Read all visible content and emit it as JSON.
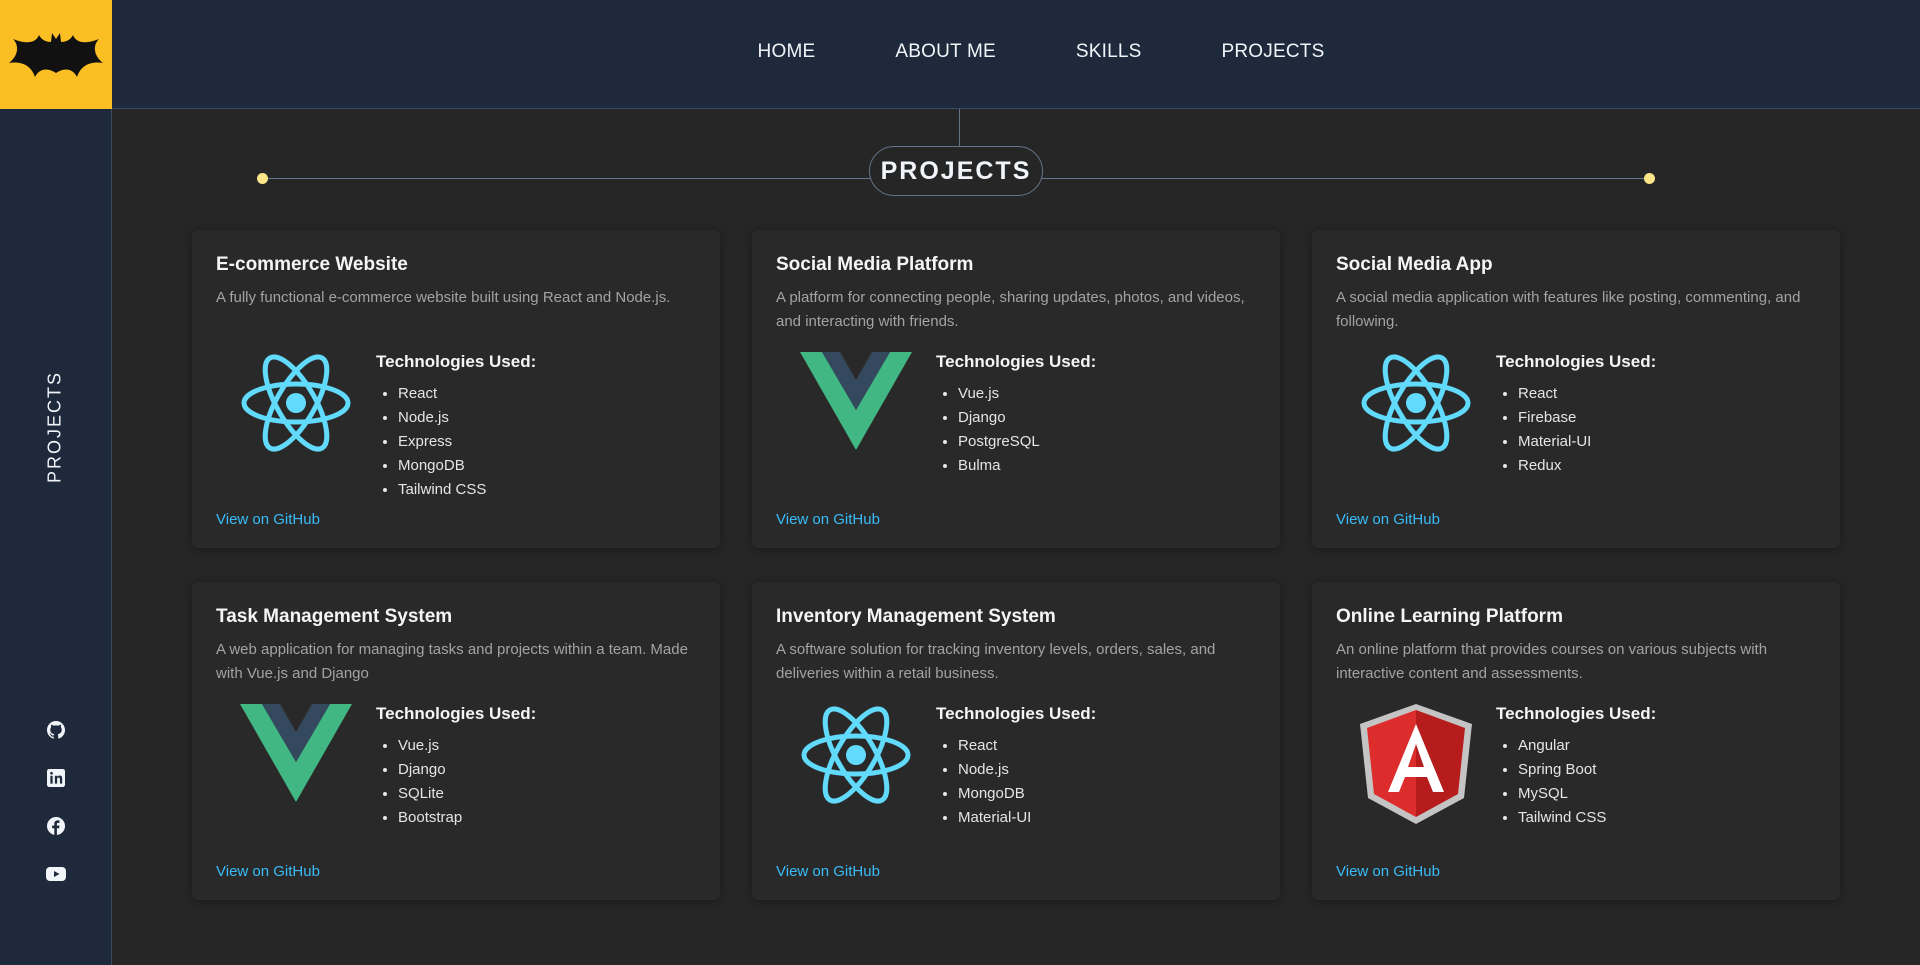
{
  "nav": {
    "items": [
      "HOME",
      "ABOUT ME",
      "SKILLS",
      "PROJECTS"
    ]
  },
  "sidebar": {
    "label": "PROJECTS",
    "social_icons": [
      "github-icon",
      "linkedin-icon",
      "facebook-icon",
      "youtube-icon"
    ]
  },
  "section": {
    "title": "PROJECTS"
  },
  "colors": {
    "accent": "#fbbf24",
    "link": "#38bdf8",
    "nav_bg": "#1e293b",
    "card_bg": "#292929"
  },
  "tech_heading": "Technologies Used:",
  "projects": [
    {
      "title": "E-commerce Website",
      "description": "A fully functional e-commerce website built using React and Node.js.",
      "logo": "react-logo-icon",
      "technologies": [
        "React",
        "Node.js",
        "Express",
        "MongoDB",
        "Tailwind CSS"
      ],
      "link_label": "View on GitHub"
    },
    {
      "title": "Social Media Platform",
      "description": "A platform for connecting people, sharing updates, photos, and videos, and interacting with friends.",
      "logo": "vue-logo-icon",
      "technologies": [
        "Vue.js",
        "Django",
        "PostgreSQL",
        "Bulma"
      ],
      "link_label": "View on GitHub"
    },
    {
      "title": "Social Media App",
      "description": "A social media application with features like posting, commenting, and following.",
      "logo": "react-logo-icon",
      "technologies": [
        "React",
        "Firebase",
        "Material-UI",
        "Redux"
      ],
      "link_label": "View on GitHub"
    },
    {
      "title": "Task Management System",
      "description": "A web application for managing tasks and projects within a team. Made with Vue.js and Django",
      "logo": "vue-logo-icon",
      "technologies": [
        "Vue.js",
        "Django",
        "SQLite",
        "Bootstrap"
      ],
      "link_label": "View on GitHub"
    },
    {
      "title": "Inventory Management System",
      "description": "A software solution for tracking inventory levels, orders, sales, and deliveries within a retail business.",
      "logo": "react-logo-icon",
      "technologies": [
        "React",
        "Node.js",
        "MongoDB",
        "Material-UI"
      ],
      "link_label": "View on GitHub"
    },
    {
      "title": "Online Learning Platform",
      "description": "An online platform that provides courses on various subjects with interactive content and assessments.",
      "logo": "angular-logo-icon",
      "technologies": [
        "Angular",
        "Spring Boot",
        "MySQL",
        "Tailwind CSS"
      ],
      "link_label": "View on GitHub"
    }
  ]
}
